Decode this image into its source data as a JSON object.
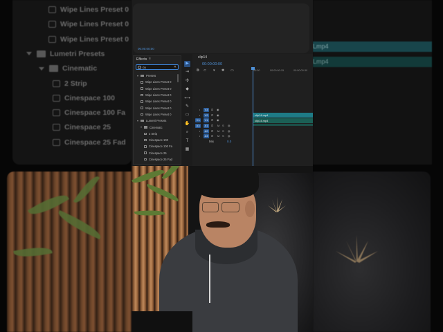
{
  "background": {
    "left_panel_items": [
      {
        "label": "Wipe Lines Preset 0",
        "kind": "preset"
      },
      {
        "label": "Wipe Lines Preset 0",
        "kind": "preset"
      },
      {
        "label": "Wipe Lines Preset 0",
        "kind": "preset"
      },
      {
        "label": "Lumetri Presets",
        "kind": "folder-open"
      },
      {
        "label": "Cinematic",
        "kind": "folder-open"
      },
      {
        "label": "2 Strip",
        "kind": "preset"
      },
      {
        "label": "Cinespace 100",
        "kind": "preset"
      },
      {
        "label": "Cinespace 100 Fa",
        "kind": "preset"
      },
      {
        "label": "Cinespace 25",
        "kind": "preset"
      },
      {
        "label": "Cinespace 25 Fad",
        "kind": "preset"
      }
    ],
    "right_clip_labels": [
      "Lmp4",
      "Lmp4"
    ]
  },
  "app": {
    "program_monitor": {
      "timecode": "00:00:00:00"
    },
    "effects_panel": {
      "title": "Effects",
      "menu": "≡",
      "search_value": "cu",
      "search_clear": "✕",
      "items": [
        {
          "label": "Presets",
          "kind": "folder",
          "indent": 1
        },
        {
          "label": "Wipe Lines Preset 0",
          "kind": "preset",
          "indent": 2
        },
        {
          "label": "Wipe Lines Preset 0",
          "kind": "preset",
          "indent": 2
        },
        {
          "label": "Wipe Lines Preset 0",
          "kind": "preset",
          "indent": 2
        },
        {
          "label": "Wipe Lines Preset 0",
          "kind": "preset",
          "indent": 2
        },
        {
          "label": "Wipe Lines Preset 0",
          "kind": "preset",
          "indent": 2
        },
        {
          "label": "Wipe Lines Preset 0",
          "kind": "preset",
          "indent": 2
        },
        {
          "label": "Lumetri Presets",
          "kind": "folder",
          "indent": 1
        },
        {
          "label": "Cinematic",
          "kind": "folder",
          "indent": 2
        },
        {
          "label": "2 Strip",
          "kind": "preset",
          "indent": 3
        },
        {
          "label": "Cinespace 100",
          "kind": "preset",
          "indent": 3
        },
        {
          "label": "Cinespace 100 Fa",
          "kind": "preset",
          "indent": 3
        },
        {
          "label": "Cinespace 25",
          "kind": "preset",
          "indent": 3
        },
        {
          "label": "Cinespace 25 Fad",
          "kind": "preset",
          "indent": 3
        }
      ]
    },
    "tools": [
      "▶",
      "⇥",
      "✣",
      "◆",
      "⟷",
      "✎",
      "▭",
      "✋",
      "⌕",
      "T",
      "▦"
    ],
    "timeline": {
      "tab": "clip14",
      "timecode": "00:00:00:00",
      "ruler": [
        "00:00",
        "00:00:00:15",
        "00:00:00:30"
      ],
      "video_tracks": [
        "V3",
        "V2",
        "V1"
      ],
      "audio_tracks": [
        "A1",
        "A2",
        "A3"
      ],
      "source_video": "V1",
      "source_audio": "A1",
      "clips": [
        {
          "name": "clip14.mp4",
          "track": "V1"
        },
        {
          "name": "clip14.mp4",
          "track": "A1"
        }
      ],
      "mix_label": "Mix",
      "mix_value": "0.0"
    }
  }
}
